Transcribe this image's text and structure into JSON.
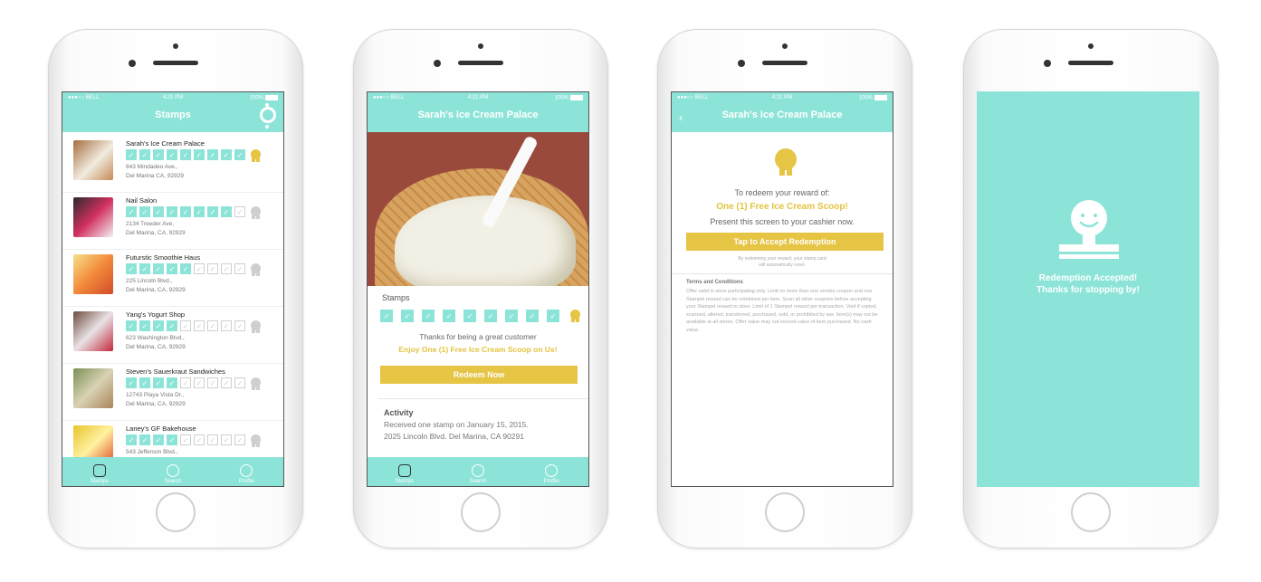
{
  "status": {
    "carrier": "●●●○○ BELL",
    "time": "4:21 PM",
    "battery": "100%"
  },
  "screen1": {
    "title": "Stamps",
    "stores": [
      {
        "name": "Sarah's Ice Cream Palace",
        "addr1": "843 Mindadeo Ave.,",
        "addr2": "Del Marina CA, 92929",
        "filled": 9
      },
      {
        "name": "Nail Salon",
        "addr1": "2134 Treeder Ave,",
        "addr2": "Del Marina, CA, 92929",
        "filled": 8
      },
      {
        "name": "Futurstic Smoothie Haus",
        "addr1": "225 Lincoln Blvd.,",
        "addr2": "Del Marina, CA, 92929",
        "filled": 5
      },
      {
        "name": "Yang's Yogurt Shop",
        "addr1": "623 Washington Blvd.,",
        "addr2": "Del Marina, CA, 92929",
        "filled": 4
      },
      {
        "name": "Steven's Sauerkraut Sandwiches",
        "addr1": "12743 Playa Vista Dr.,",
        "addr2": "Del Marina, CA, 92929",
        "filled": 4
      },
      {
        "name": "Laney's GF Bakehouse",
        "addr1": "543 Jefferson Blvd.,",
        "addr2": "",
        "filled": 4
      }
    ],
    "total_stamps": 9,
    "tabs": [
      "Stamps",
      "Search",
      "Profile"
    ]
  },
  "screen2": {
    "title": "Sarah's Ice Cream Palace",
    "stamps_label": "Stamps",
    "filled": 9,
    "thanks": "Thanks for being a great customer",
    "offer": "Enjoy One (1) Free Ice Cream Scoop on Us!",
    "redeem_button": "Redeem Now",
    "activity_label": "Activity",
    "activity_line1": "Received one stamp on January 15, 2015.",
    "activity_line2": "2025 Lincoln Blvd. Del Marina, CA 90291",
    "tabs": [
      "Stamps",
      "Search",
      "Profile"
    ]
  },
  "screen3": {
    "title": "Sarah's Ice Cream Palace",
    "back_glyph": "‹",
    "to_redeem": "To redeem your reward of:",
    "reward": "One (1) Free Ice Cream Scoop!",
    "present": "Present this screen to your cashier now.",
    "accept_button": "Tap to Accept Redemption",
    "reset_note_1": "By redeeming your reward, your stamp card",
    "reset_note_2": "will automatically reset.",
    "terms_label": "Terms and Conditions",
    "terms_body": "Offer valid in store participating only. Limit no more than one vendor coupon and one Stampel reward can be combined per item. Scan all other coupons before accepting your Stampel reward in store. Limit of 1 Stampel reward per transaction. Void if copied, scanned, altered, transferred, purchased, sold, or prohibited by law. Item(s) may not be available at all stores. Offer value may not exceed value of item purchased. No cash value."
  },
  "screen4": {
    "line1": "Redemption Accepted!",
    "line2": "Thanks for stopping by!"
  },
  "colors": {
    "teal": "#8ce4d8",
    "gold": "#e3c33f"
  }
}
